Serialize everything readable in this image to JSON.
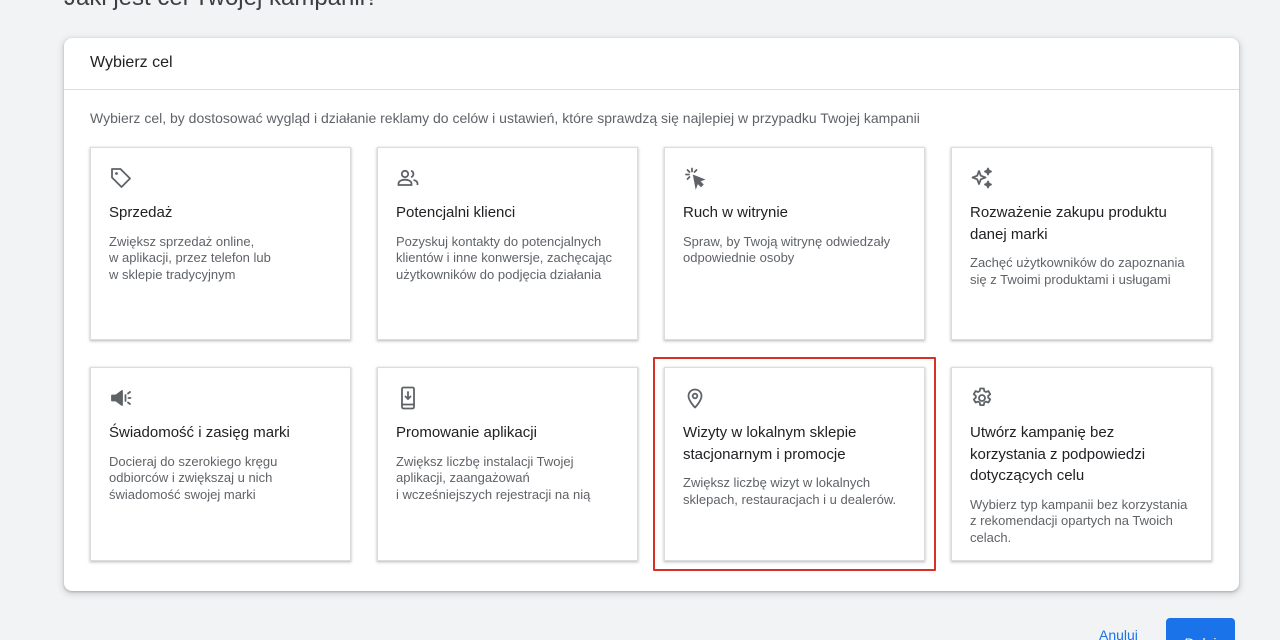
{
  "page": {
    "heading": "Jaki jest cel Twojej kampanii?"
  },
  "panel": {
    "header": "Wybierz cel",
    "description": "Wybierz cel, by dostosować wygląd i działanie reklamy do celów i ustawień, które sprawdzą się najlepiej w przypadku Twojej kampanii"
  },
  "goals": [
    {
      "icon": "tag-icon",
      "title": "Sprzedaż",
      "description": "Zwiększ sprzedaż online,\nw aplikacji, przez telefon lub\nw sklepie tradycyjnym"
    },
    {
      "icon": "people-icon",
      "title": "Potencjalni klienci",
      "description": "Pozyskuj kontakty do potencjalnych klientów i inne konwersje, zachęcając użytkowników do podjęcia działania"
    },
    {
      "icon": "cursor-click-icon",
      "title": "Ruch w witrynie",
      "description": "Spraw, by Twoją witrynę odwiedzały odpowiednie osoby"
    },
    {
      "icon": "sparkle-icon",
      "title": "Rozważenie zakupu produktu danej marki",
      "description": "Zachęć użytkowników do zapoznania się z Twoimi produktami i usługami"
    },
    {
      "icon": "megaphone-icon",
      "title": "Świadomość i zasięg marki",
      "description": "Docieraj do szerokiego kręgu odbiorców i zwiększaj u nich świadomość swojej marki"
    },
    {
      "icon": "phone-download-icon",
      "title": "Promowanie aplikacji",
      "description": "Zwiększ liczbę instalacji Twojej aplikacji, zaangażowań\ni wcześniejszych rejestracji na nią"
    },
    {
      "icon": "location-pin-icon",
      "title": "Wizyty w lokalnym sklepie stacjonarnym i promocje",
      "description": "Zwiększ liczbę wizyt w lokalnych sklepach, restauracjach i u dealerów."
    },
    {
      "icon": "gear-icon",
      "title": "Utwórz kampanię bez korzystania z podpowiedzi dotyczących celu",
      "description": "Wybierz typ kampanii bez korzystania z rekomendacji opartych na Twoich celach."
    }
  ],
  "footer": {
    "cancel_label": "Anuluj",
    "next_label": "Dalej"
  },
  "colors": {
    "accent": "#1a73e8",
    "highlight": "#d93025",
    "icon": "#5f6368"
  }
}
